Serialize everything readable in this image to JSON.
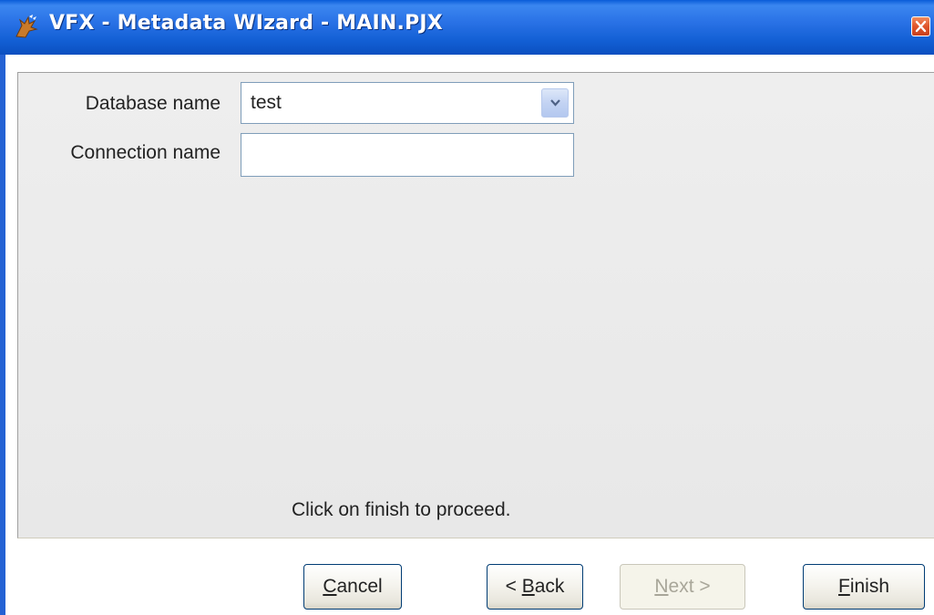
{
  "window": {
    "title": "VFX - Metadata WIzard - MAIN.PJX",
    "icon": "fox-app-icon",
    "title_bar_color": "#2a72e6",
    "close_button_color": "#e0552b"
  },
  "form": {
    "database_label": "Database name",
    "database_value": "test",
    "connection_label": "Connection name",
    "connection_value": ""
  },
  "hint": "Click on finish to proceed.",
  "buttons": {
    "cancel": {
      "mnemonic": "C",
      "rest": "ancel",
      "enabled": true
    },
    "back": {
      "prefix": "< ",
      "mnemonic": "B",
      "rest": "ack",
      "enabled": true
    },
    "next": {
      "mnemonic": "N",
      "rest": "ext >",
      "enabled": false
    },
    "finish": {
      "mnemonic": "F",
      "rest": "inish",
      "enabled": true
    }
  }
}
